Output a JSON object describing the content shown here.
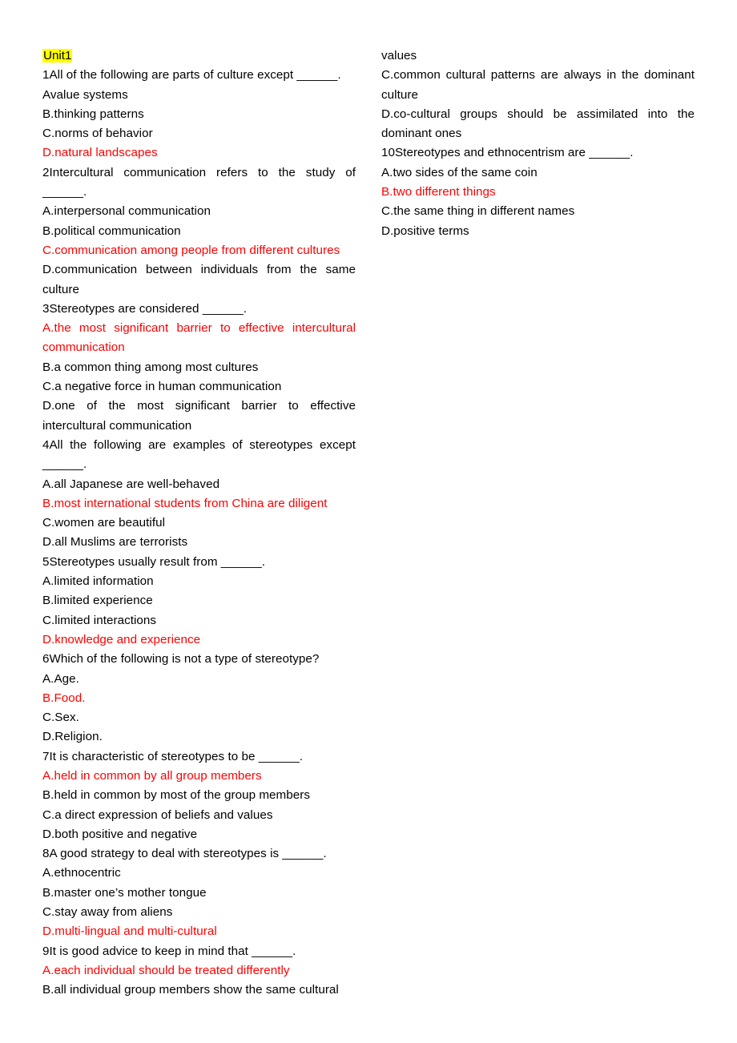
{
  "document": {
    "title": "Unit1",
    "highlight_color": "#ffff00",
    "answer_color": "#ff0000",
    "body_color": "#000000",
    "background_color": "#ffffff"
  },
  "left_column": {
    "heading": "Unit1",
    "lines": [
      {
        "text": "1All of the following are parts of culture except ______.",
        "answer": false,
        "justify": false
      },
      {
        "text": "Avalue systems",
        "answer": false,
        "justify": false
      },
      {
        "text": "B.thinking patterns",
        "answer": false,
        "justify": false
      },
      {
        "text": "C.norms of behavior",
        "answer": false,
        "justify": false
      },
      {
        "text": "D.natural landscapes",
        "answer": true,
        "justify": false
      },
      {
        "text": "2Intercultural communication refers to the study of ______.",
        "answer": false,
        "justify": true
      },
      {
        "text": "A.interpersonal communication",
        "answer": false,
        "justify": false
      },
      {
        "text": "B.political communication",
        "answer": false,
        "justify": false
      },
      {
        "text": "C.communication among people from different cultures",
        "answer": true,
        "justify": false
      },
      {
        "text": "D.communication between individuals from the same culture",
        "answer": false,
        "justify": true
      },
      {
        "text": "3Stereotypes are considered ______.",
        "answer": false,
        "justify": false
      },
      {
        "text": "A.the most significant barrier to effective intercultural communication",
        "answer": true,
        "justify": true
      },
      {
        "text": "B.a common thing among most cultures",
        "answer": false,
        "justify": false
      },
      {
        "text": "C.a negative force in human communication",
        "answer": false,
        "justify": false
      },
      {
        "text": "D.one of the most significant barrier to effective intercultural communication",
        "answer": false,
        "justify": true
      },
      {
        "text": "4All the following are examples of stereotypes except ______.",
        "answer": false,
        "justify": true
      },
      {
        "text": "A.all Japanese are well-behaved",
        "answer": false,
        "justify": false
      },
      {
        "text": "B.most international students from China are diligent",
        "answer": true,
        "justify": false
      },
      {
        "text": "C.women are beautiful",
        "answer": false,
        "justify": false
      },
      {
        "text": "D.all Muslims are terrorists",
        "answer": false,
        "justify": false
      },
      {
        "text": "5Stereotypes usually result from ______.",
        "answer": false,
        "justify": false
      },
      {
        "text": "A.limited information",
        "answer": false,
        "justify": false
      },
      {
        "text": "B.limited experience",
        "answer": false,
        "justify": false
      },
      {
        "text": "C.limited interactions",
        "answer": false,
        "justify": false
      },
      {
        "text": "D.knowledge and experience",
        "answer": true,
        "justify": false
      },
      {
        "text": "6Which of the following is not a type of stereotype?",
        "answer": false,
        "justify": false
      },
      {
        "text": "A.Age.",
        "answer": false,
        "justify": false
      },
      {
        "text": "B.Food.",
        "answer": true,
        "justify": false
      },
      {
        "text": "C.Sex.",
        "answer": false,
        "justify": false
      },
      {
        "text": "D.Religion.",
        "answer": false,
        "justify": false
      },
      {
        "text": "7It is characteristic of stereotypes to be ______.",
        "answer": false,
        "justify": false
      },
      {
        "text": "A.held in common by all group members",
        "answer": true,
        "justify": false
      },
      {
        "text": "B.held in common by most of the group members",
        "answer": false,
        "justify": false
      },
      {
        "text": "C.a direct expression of beliefs and values",
        "answer": false,
        "justify": false
      },
      {
        "text": "D.both positive and negative",
        "answer": false,
        "justify": false
      },
      {
        "text": "8A good strategy to deal with stereotypes is ______.",
        "answer": false,
        "justify": false
      },
      {
        "text": "A.ethnocentric",
        "answer": false,
        "justify": false
      },
      {
        "text": "B.master one’s mother tongue",
        "answer": false,
        "justify": false
      },
      {
        "text": "C.stay away from aliens",
        "answer": false,
        "justify": false
      },
      {
        "text": "D.multi-lingual and multi-cultural",
        "answer": true,
        "justify": false
      },
      {
        "text": "9It is good advice to keep in mind that ______.",
        "answer": false,
        "justify": false
      },
      {
        "text": "A.each individual should be treated differently",
        "answer": true,
        "justify": false
      },
      {
        "text": "B.all individual group members show the same cultural",
        "answer": false,
        "justify": true
      }
    ]
  },
  "right_column": {
    "lines": [
      {
        "text": "values",
        "answer": false,
        "justify": false
      },
      {
        "text": "C.common cultural patterns are always in the dominant culture",
        "answer": false,
        "justify": true
      },
      {
        "text": "D.co-cultural groups should be assimilated into the dominant ones",
        "answer": false,
        "justify": true
      },
      {
        "text": "10Stereotypes and ethnocentrism are ______.",
        "answer": false,
        "justify": false
      },
      {
        "text": "A.two sides of the same coin",
        "answer": false,
        "justify": false
      },
      {
        "text": "B.two different things",
        "answer": true,
        "justify": false
      },
      {
        "text": "C.the same thing in different names",
        "answer": false,
        "justify": false
      },
      {
        "text": "D.positive terms",
        "answer": false,
        "justify": false
      }
    ]
  }
}
